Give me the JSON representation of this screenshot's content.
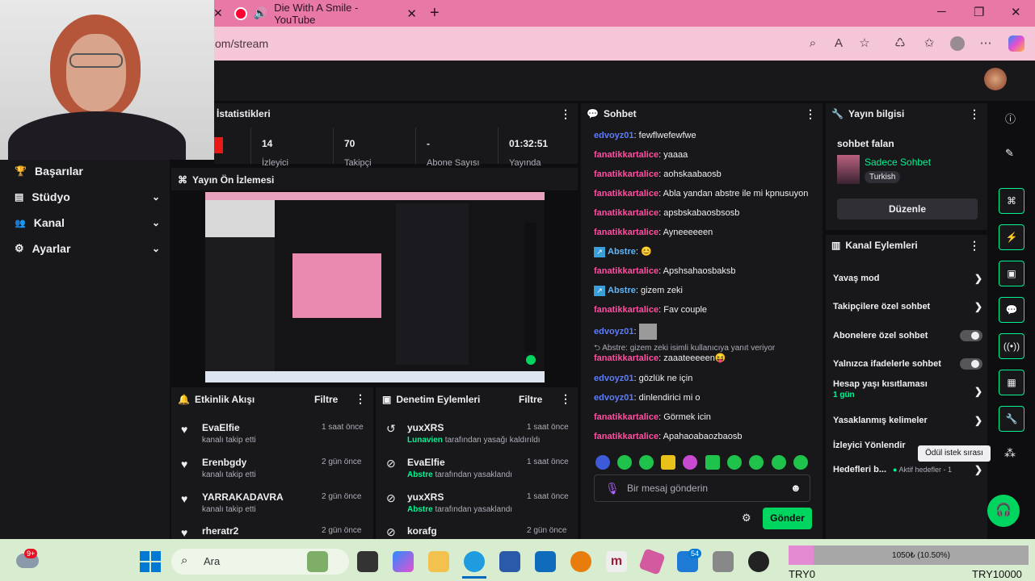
{
  "browser": {
    "tab_title": "Die With A Smile - YouTube",
    "url": "om/stream",
    "new_tab": "+",
    "minimize": "─",
    "restore": "❐",
    "close": "✕"
  },
  "left_nav": {
    "items": [
      {
        "label": "Başarılar",
        "icon": "trophy-icon",
        "glyph": "🏆"
      },
      {
        "label": "Stüdyo",
        "icon": "film-icon",
        "glyph": "▤",
        "chevron": "⌄"
      },
      {
        "label": "Kanal",
        "icon": "people-icon",
        "glyph": "👥",
        "chevron": "⌄"
      },
      {
        "label": "Ayarlar",
        "icon": "gear-icon",
        "glyph": "⚙",
        "chevron": "⌄"
      }
    ]
  },
  "stats": {
    "title": "İstatistikleri",
    "items": [
      {
        "value": "14",
        "label": "İzleyici"
      },
      {
        "value": "70",
        "label": "Takipçi"
      },
      {
        "value": "-",
        "label": "Abone Sayısı"
      },
      {
        "value": "01:32:51",
        "label": "Yayında"
      }
    ]
  },
  "preview": {
    "title": "Yayın Ön İzlemesi"
  },
  "activity": {
    "title": "Etkinlik Akışı",
    "filter": "Filtre",
    "items": [
      {
        "name": "EvaElfie",
        "sub": "kanalı takip etti",
        "time": "1 saat önce"
      },
      {
        "name": "Erenbgdy",
        "sub": "kanalı takip etti",
        "time": "2 gün önce"
      },
      {
        "name": "YARRAKADAVRA",
        "sub": "kanalı takip etti",
        "time": "2 gün önce"
      },
      {
        "name": "rheratr2",
        "sub": "",
        "time": "2 gün önce"
      }
    ]
  },
  "moderation": {
    "title": "Denetim Eylemleri",
    "filter": "Filtre",
    "items": [
      {
        "name": "yuxXRS",
        "actor": "Lunavien",
        "action": "tarafından yasağı kaldırıldı",
        "time": "1 saat önce"
      },
      {
        "name": "EvaElfie",
        "actor": "Abstre",
        "action": "tarafından yasaklandı",
        "time": "1 saat önce"
      },
      {
        "name": "yuxXRS",
        "actor": "Abstre",
        "action": "tarafından yasaklandı",
        "time": "1 saat önce"
      },
      {
        "name": "korafg",
        "actor": "",
        "action": "",
        "time": "2 gün önce"
      }
    ]
  },
  "chat": {
    "title": "Sohbet",
    "messages": [
      {
        "user": "edvoyz01",
        "text": "fewflwefewfwe",
        "color": "blue"
      },
      {
        "user": "fanatikkartalice",
        "text": "yaaaa",
        "color": "pink"
      },
      {
        "user": "fanatikkartalice",
        "text": "aohskaabaosb",
        "color": "pink"
      },
      {
        "user": "fanatikkartalice",
        "text": "Abla yandan abstre ile mi kpnusuyon",
        "color": "pink"
      },
      {
        "user": "fanatikkartalice",
        "text": "apsbskabaosbsosb",
        "color": "pink"
      },
      {
        "user": "fanatikkartalice",
        "text": "Ayneeeeeen",
        "color": "pink"
      },
      {
        "user": "Abstre",
        "text": "😊",
        "color": "abs"
      },
      {
        "user": "fanatikkartalice",
        "text": "Apshsahaosbaksb",
        "color": "pink"
      },
      {
        "user": "Abstre",
        "text": "gizem zeki",
        "color": "abs"
      },
      {
        "user": "fanatikkartalice",
        "text": "Fav couple",
        "color": "pink"
      },
      {
        "user": "edvoyz01",
        "text": "",
        "color": "blue"
      },
      {
        "user": "fanatikkartalice",
        "text": "zaaateeeeen😝",
        "color": "pink"
      },
      {
        "user": "edvoyz01",
        "text": "gözlük ne için",
        "color": "blue"
      },
      {
        "user": "edvoyz01",
        "text": "dinlendirici mi o",
        "color": "blue"
      },
      {
        "user": "fanatikkartalice",
        "text": "Görmek icin",
        "color": "pink"
      },
      {
        "user": "fanatikkartalice",
        "text": "Apahaoabaozbaosb",
        "color": "pink"
      }
    ],
    "reply_note": "Abstre: gizem zeki isimli kullanıcıya yanıt veriyor",
    "input_placeholder": "Bir mesaj gönderin",
    "send_label": "Gönder"
  },
  "stream_info": {
    "title": "Yayın bilgisi",
    "stream_title": "sohbet falan",
    "category": "Sadece Sohbet",
    "language": "Turkish",
    "edit_label": "Düzenle"
  },
  "channel_actions": {
    "title": "Kanal Eylemleri",
    "rows": [
      {
        "label": "Yavaş mod",
        "kind": "chevron"
      },
      {
        "label": "Takipçilere özel sohbet",
        "kind": "chevron"
      },
      {
        "label": "Abonelere özel sohbet",
        "kind": "toggle"
      },
      {
        "label": "Yalnızca ifadelerle sohbet",
        "kind": "toggle"
      },
      {
        "label": "Hesap yaşı kısıtlaması",
        "sub": "1 gün",
        "kind": "chevron"
      },
      {
        "label": "Yasaklanmış kelimeler",
        "kind": "chevron"
      },
      {
        "label": "İzleyici Yönlendir",
        "kind": "none"
      },
      {
        "label": "Hedefleri b...",
        "sub_inline": "Aktif hedefler - 1",
        "kind": "chevron"
      }
    ]
  },
  "tooltip": "Ödül istek sırası",
  "taskbar": {
    "search": "Ara",
    "badge": "9+",
    "notif": "54",
    "try_left": "TRY0",
    "try_right": "TRY10000",
    "progress_text": "1050₺ (10.50%)",
    "progress_fraction": 0.105
  }
}
